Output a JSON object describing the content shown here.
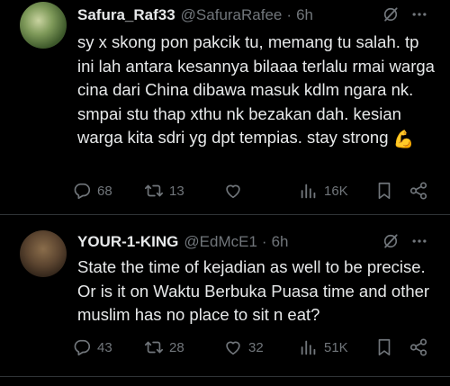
{
  "tweets": [
    {
      "name": "Safura_Raf33",
      "handle": "@SafuraRafee",
      "dot": "·",
      "time": "6h",
      "text": "sy x skong pon pakcik tu, memang tu salah. tp ini lah antara kesannya bilaaa terlalu rmai warga cina dari China dibawa masuk kdlm ngara nk. smpai stu thap xthu nk bezakan dah. kesian warga kita sdri yg dpt tempias. stay strong",
      "emoji": "💪",
      "replies": "68",
      "reposts": "13",
      "likes": "",
      "views": "16K"
    },
    {
      "name": "YOUR-1-KING",
      "handle": "@EdMcE1",
      "dot": "·",
      "time": "6h",
      "text": "State the time of kejadian as well to be precise. Or is it on Waktu Berbuka Puasa time and other muslim has no place to sit n eat?",
      "emoji": "",
      "replies": "43",
      "reposts": "28",
      "likes": "32",
      "views": "51K"
    }
  ],
  "colors": {
    "background": "#000000",
    "text": "#e7e9ea",
    "muted": "#71767b",
    "divider": "#2f3336"
  },
  "icons": [
    "grok-icon",
    "more-icon",
    "reply-icon",
    "repost-icon",
    "like-icon",
    "views-icon",
    "bookmark-icon",
    "share-icon"
  ]
}
